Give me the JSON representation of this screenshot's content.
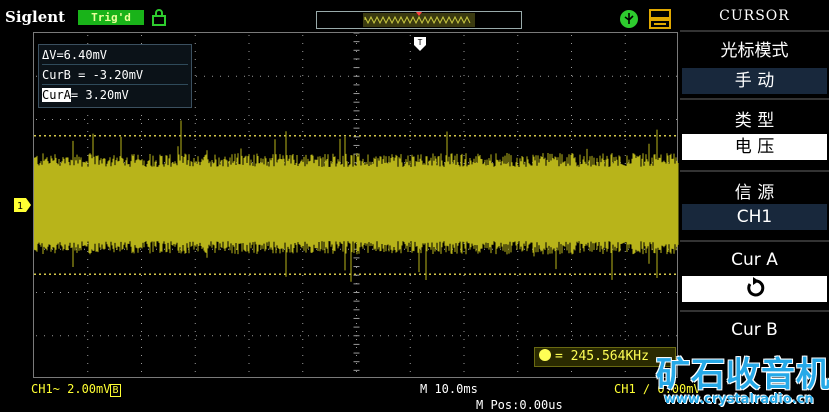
{
  "header": {
    "brand": "Siglent",
    "trigger_status": "Trig'd",
    "icons": [
      "lock-icon",
      "usb-icon",
      "printer-icon"
    ]
  },
  "readout": {
    "delta": "ΔV=6.40mV",
    "curb": "CurB = -3.20mV",
    "cura_tag": "CurA",
    "cura_value": "= 3.20mV"
  },
  "frequency": "= 245.564KHz",
  "bottom": {
    "ch1_label": "CH1~ 2.00mV",
    "ch1_bw": "B",
    "timebase": "M 10.0ms",
    "mpos": "M Pos:0.00us",
    "trigger": "CH1 ∕ 0.00mV"
  },
  "menu": {
    "title": "CURSOR",
    "items": [
      {
        "label": "光标模式",
        "value": "手  动"
      },
      {
        "label": "类  型",
        "value": "电  压"
      },
      {
        "label": "信  源",
        "value": "CH1"
      },
      {
        "label": "Cur A",
        "value_icon": "rotate-knob-icon"
      },
      {
        "label": "Cur B",
        "value_icon": ""
      }
    ]
  },
  "watermark": {
    "cn": "矿石收音机",
    "url": "www.crystalradio.cn"
  },
  "colors": {
    "trace": "#b8b41a",
    "grid": "#9a9a9a",
    "cursor_line": "#d4c84a",
    "menu_highlight": "#18283c",
    "trigd_bg": "#19b319"
  }
}
